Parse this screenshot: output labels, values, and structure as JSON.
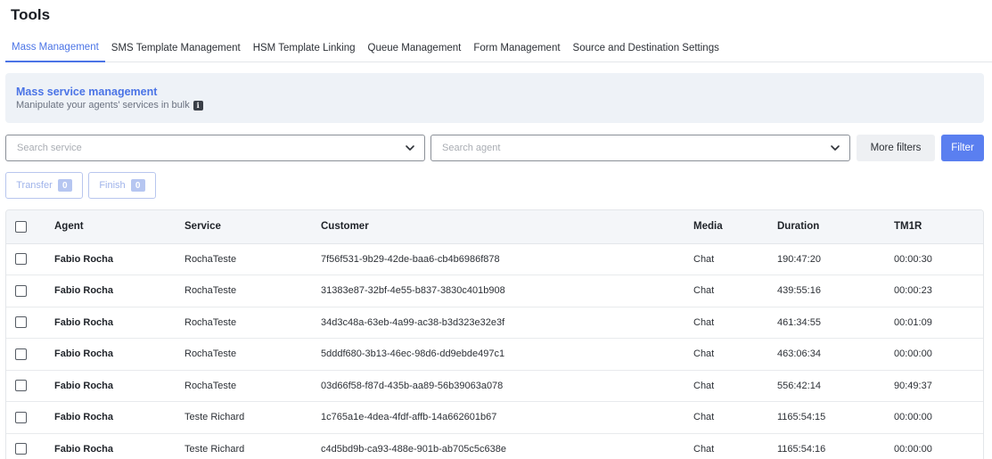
{
  "page": {
    "title": "Tools"
  },
  "tabs": [
    {
      "label": "Mass Management",
      "active": true
    },
    {
      "label": "SMS Template Management",
      "active": false
    },
    {
      "label": "HSM Template Linking",
      "active": false
    },
    {
      "label": "Queue Management",
      "active": false
    },
    {
      "label": "Form Management",
      "active": false
    },
    {
      "label": "Source and Destination Settings",
      "active": false
    }
  ],
  "banner": {
    "title": "Mass service management",
    "subtitle": "Manipulate your agents' services in bulk",
    "info_icon": "info-icon"
  },
  "filters": {
    "service_placeholder": "Search service",
    "agent_placeholder": "Search agent",
    "more_filters_label": "More filters",
    "filter_label": "Filter"
  },
  "actions": {
    "transfer_label": "Transfer",
    "transfer_count": "0",
    "finish_label": "Finish",
    "finish_count": "0"
  },
  "table": {
    "headers": {
      "agent": "Agent",
      "service": "Service",
      "customer": "Customer",
      "media": "Media",
      "duration": "Duration",
      "tm1r": "TM1R"
    },
    "rows": [
      {
        "agent": "Fabio Rocha",
        "service": "RochaTeste",
        "customer": "7f56f531-9b29-42de-baa6-cb4b6986f878",
        "media": "Chat",
        "duration": "190:47:20",
        "tm1r": "00:00:30"
      },
      {
        "agent": "Fabio Rocha",
        "service": "RochaTeste",
        "customer": "31383e87-32bf-4e55-b837-3830c401b908",
        "media": "Chat",
        "duration": "439:55:16",
        "tm1r": "00:00:23"
      },
      {
        "agent": "Fabio Rocha",
        "service": "RochaTeste",
        "customer": "34d3c48a-63eb-4a99-ac38-b3d323e32e3f",
        "media": "Chat",
        "duration": "461:34:55",
        "tm1r": "00:01:09"
      },
      {
        "agent": "Fabio Rocha",
        "service": "RochaTeste",
        "customer": "5dddf680-3b13-46ec-98d6-dd9ebde497c1",
        "media": "Chat",
        "duration": "463:06:34",
        "tm1r": "00:00:00"
      },
      {
        "agent": "Fabio Rocha",
        "service": "RochaTeste",
        "customer": "03d66f58-f87d-435b-aa89-56b39063a078",
        "media": "Chat",
        "duration": "556:42:14",
        "tm1r": "90:49:37"
      },
      {
        "agent": "Fabio Rocha",
        "service": "Teste Richard",
        "customer": "1c765a1e-4dea-4fdf-affb-14a662601b67",
        "media": "Chat",
        "duration": "1165:54:15",
        "tm1r": "00:00:00"
      },
      {
        "agent": "Fabio Rocha",
        "service": "Teste Richard",
        "customer": "c4d5bd9b-ca93-488e-901b-ab705c5c638e",
        "media": "Chat",
        "duration": "1165:54:16",
        "tm1r": "00:00:00"
      }
    ]
  },
  "colors": {
    "accent": "#4b74e6",
    "primary_button": "#5a7ff0",
    "banner_bg": "#eef2f7"
  }
}
